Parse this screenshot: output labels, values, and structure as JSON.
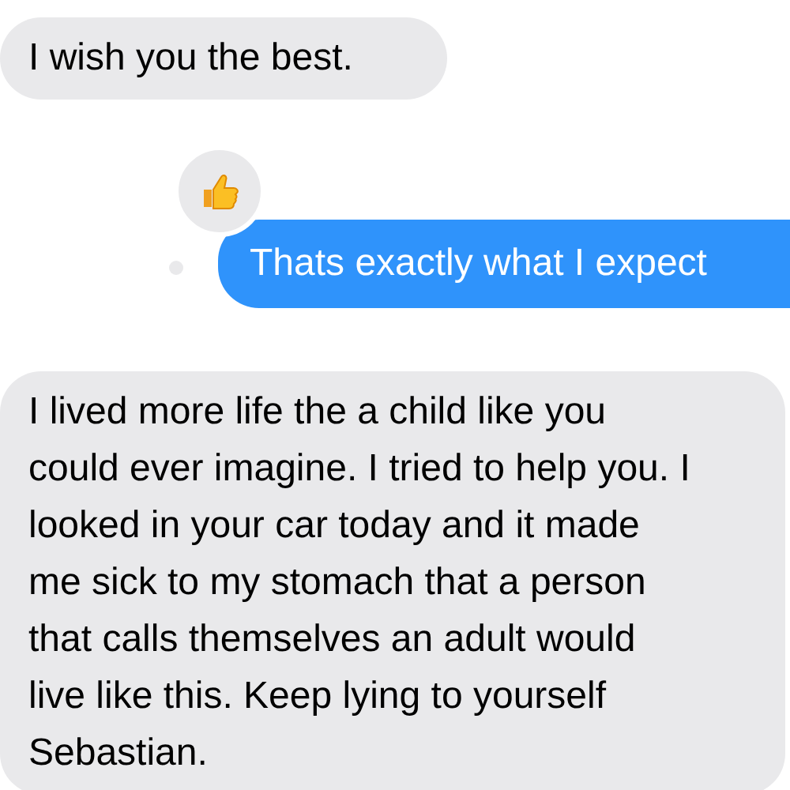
{
  "messages": [
    {
      "kind": "incoming",
      "text": "I wish you the best."
    },
    {
      "kind": "outgoing",
      "text": "Thats exactly what I expect",
      "liked": true
    },
    {
      "kind": "incoming",
      "text": "I lived more life the a child like you could ever imagine. I tried to help you. I looked in your car today and it made me sick to my stomach that a person that calls themselves an adult would live like this. Keep lying to yourself Sebastian."
    }
  ]
}
